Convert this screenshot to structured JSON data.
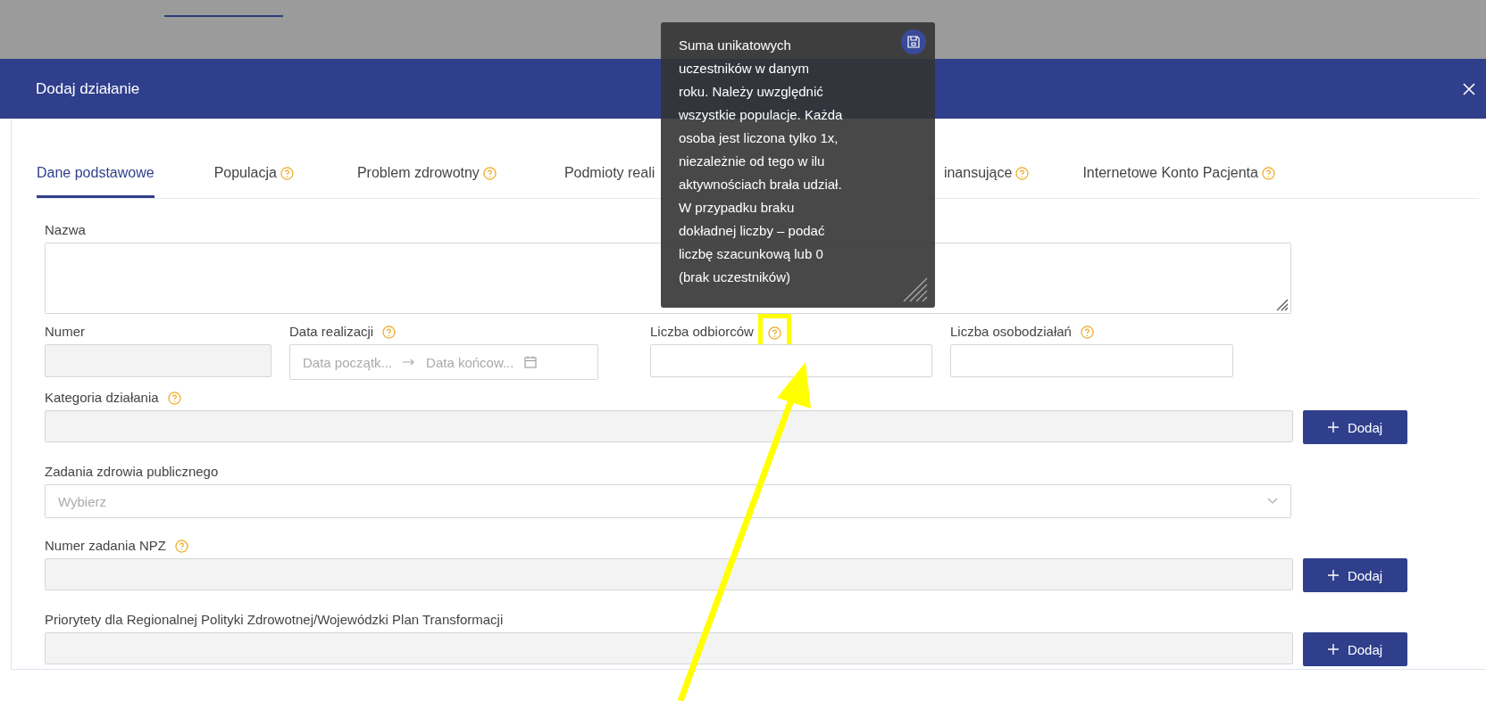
{
  "dialog": {
    "title": "Dodaj działanie"
  },
  "tabs": [
    {
      "label": "Dane podstawowe",
      "selected": true,
      "help": false
    },
    {
      "label": "Populacja",
      "selected": false,
      "help": true
    },
    {
      "label": "Problem zdrowotny",
      "selected": false,
      "help": true
    },
    {
      "label": "Podmioty reali",
      "selected": false,
      "help": false
    },
    {
      "label": "inansujące",
      "selected": false,
      "help": true
    },
    {
      "label": "Internetowe Konto Pacjenta",
      "selected": false,
      "help": true
    }
  ],
  "rows": [
    [
      {
        "kind": "textarea",
        "label": "Nazwa",
        "help": false,
        "disabled": false,
        "highlighted": false
      }
    ],
    [
      {
        "kind": "text",
        "label": "Numer",
        "help": false,
        "disabled": true,
        "highlighted": false
      },
      {
        "kind": "daterange",
        "label": "Data realizacji",
        "help": true,
        "disabled": false,
        "highlighted": false,
        "placeholders": [
          "Data początk...",
          "Data końcow..."
        ]
      },
      {
        "kind": "text",
        "label": "Liczba odbiorców",
        "help": true,
        "disabled": false,
        "highlighted": true
      },
      {
        "kind": "text",
        "label": "Liczba osobodziałań",
        "help": true,
        "disabled": false,
        "highlighted": false
      }
    ],
    [
      {
        "kind": "text",
        "label": "Kategoria działania",
        "help": true,
        "disabled": true,
        "highlighted": false,
        "button": "Dodaj"
      }
    ],
    [
      {
        "kind": "select",
        "label": "Zadania zdrowia publicznego",
        "help": false,
        "disabled": false,
        "highlighted": false,
        "placeholder": "Wybierz"
      }
    ],
    [
      {
        "kind": "text",
        "label": "Numer zadania NPZ",
        "help": true,
        "disabled": true,
        "highlighted": false,
        "button": "Dodaj"
      }
    ],
    [
      {
        "kind": "text",
        "label": "Priorytety dla Regionalnej Polityki Zdrowotnej/Wojewódzki Plan Transformacji",
        "help": false,
        "disabled": true,
        "highlighted": false,
        "button": "Dodaj"
      }
    ]
  ],
  "tooltip": {
    "text": "Suma unikatowych\nuczestników w danym\nroku. Należy uwzględnić\nwszystkie populacje. Każda\nosoba jest liczona tylko 1x,\nniezależnie od tego w ilu\naktywnościach brała udział.\nW przypadku braku\ndokładnej liczby – podać\nliczbę szacunkową lub 0\n(brak uczestników)"
  }
}
